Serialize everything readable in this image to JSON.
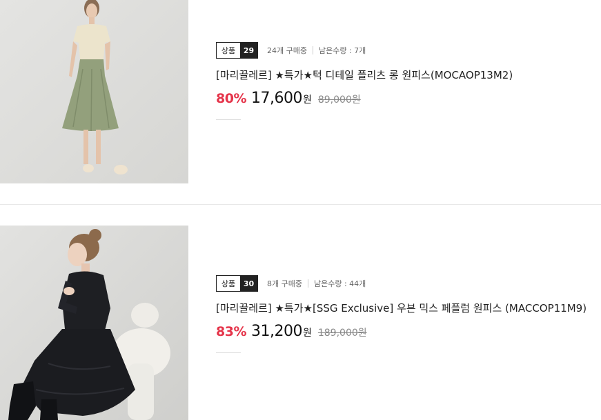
{
  "products": [
    {
      "image_alt": "model wearing beige top and sage green pleated dress",
      "lot_label": "상품",
      "lot_number": "29",
      "purchase_count": "24개 구매중",
      "stock_left": "남은수량 : 7개",
      "title": "[마리끌레르] ★특가★턱 디테일 플리츠 롱 원피스(MOCAOP13M2)",
      "discount": "80%",
      "sale_price": "17,600",
      "currency": "원",
      "original_price": "89,000원"
    },
    {
      "image_alt": "model in black long dress seated on white chair",
      "lot_label": "상품",
      "lot_number": "30",
      "purchase_count": "8개 구매중",
      "stock_left": "남은수량 : 44개",
      "title": "[마리끌레르] ★특가★[SSG Exclusive] 우븐 믹스 페플럼 원피스 (MACCOP11M9)",
      "discount": "83%",
      "sale_price": "31,200",
      "currency": "원",
      "original_price": "189,000원"
    }
  ],
  "colors": {
    "discount": "#e5344a",
    "badge_dark": "#222222"
  }
}
